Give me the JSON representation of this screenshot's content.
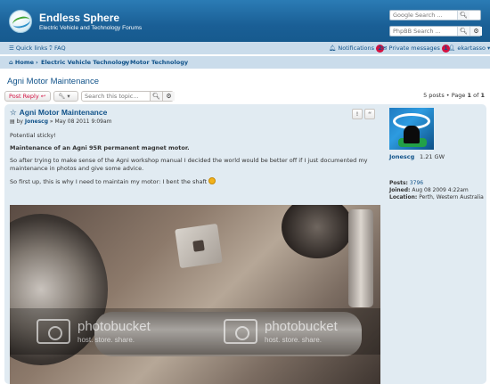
{
  "header": {
    "site_title": "Endless Sphere",
    "site_subtitle": "Electric Vehicle and Technology Forums",
    "google_search_placeholder": "Google Search ...",
    "phpbb_search_placeholder": "PhpBB Search ..."
  },
  "navbar": {
    "quick_links": "Quick links",
    "faq": "FAQ",
    "notifications": "Notifications",
    "notifications_count": "2",
    "private_messages": "Private messages",
    "private_messages_count": "1",
    "username": "ekartasso"
  },
  "breadcrumbs": [
    "Home",
    "Electric Vehicle Technology",
    "Motor Technology"
  ],
  "topic": {
    "title": "Agni Motor Maintenance",
    "post_reply": "Post Reply",
    "search_placeholder": "Search this topic...",
    "pagination": {
      "posts": "5 posts",
      "page_label": "Page",
      "current": "1",
      "of": "of",
      "total": "1"
    }
  },
  "post": {
    "title": "Agni Motor Maintenance",
    "by": "by",
    "author": "Jonescg",
    "date": "» May 08 2011 9:09am",
    "quote_icon": "quote-icon",
    "report_icon": "report-icon",
    "body": [
      "Potential sticky!",
      "Maintenance of an Agni 95R permanent magnet motor.",
      "So after trying to make sense of the Agni workshop manual I decided the world would be better off if I just documented my maintenance in photos and give some advice.",
      "So first up, this is why I need to maintain my motor: I bent the shaft"
    ],
    "watermark": {
      "name": "photobucket",
      "tag": "host. store. share."
    }
  },
  "profile": {
    "name": "Jonescg",
    "rank": "1.21 GW",
    "posts_label": "Posts:",
    "posts": "3796",
    "joined_label": "Joined:",
    "joined": "Aug 08 2009 4:22am",
    "location_label": "Location:",
    "location": "Perth, Western Australia"
  },
  "colors": {
    "header": "#1a5f96",
    "nav": "#cadceb",
    "post_bg": "#e1ebf2",
    "link": "#105289",
    "accent": "#d31141"
  }
}
